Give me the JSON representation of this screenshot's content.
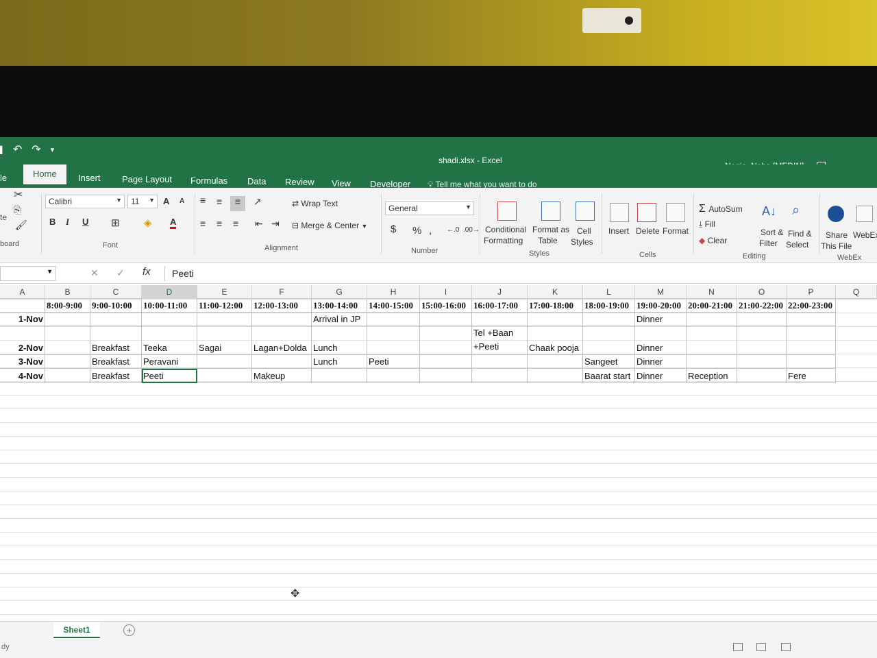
{
  "quick_access": {
    "undo": "↶",
    "redo": "↷"
  },
  "title": {
    "document": "shadi.xlsx  -  Excel",
    "user": "Nogia, Neha [MEDIN]"
  },
  "tabs": [
    "le",
    "Home",
    "Insert",
    "Page Layout",
    "Formulas",
    "Data",
    "Review",
    "View",
    "Developer"
  ],
  "tell_me": "Tell me what you want to do",
  "ribbon": {
    "clipboard_label": "board",
    "paste_partial": "te",
    "font_name": "Calibri",
    "font_size": "11",
    "font_label": "Font",
    "bold": "B",
    "italic": "I",
    "underline": "U",
    "grow_font": "A",
    "shrink_font": "A",
    "wrap_text": "Wrap Text",
    "merge_center": "Merge & Center",
    "alignment_label": "Alignment",
    "number_format": "General",
    "currency": "$",
    "percent": "%",
    "comma": ",",
    "number_label": "Number",
    "conditional_formatting": "Conditional",
    "conditional_formatting_2": "Formatting",
    "format_as_table": "Format as",
    "format_as_table_2": "Table",
    "cell_styles": "Cell",
    "cell_styles_2": "Styles",
    "styles_label": "Styles",
    "insert": "Insert",
    "delete": "Delete",
    "format": "Format",
    "cells_label": "Cells",
    "autosum": "AutoSum",
    "fill": "Fill",
    "clear": "Clear",
    "sort_filter": "Sort &",
    "sort_filter_2": "Filter",
    "find_select": "Find &",
    "find_select_2": "Select",
    "editing_label": "Editing",
    "share": "Share",
    "share_2": "This File",
    "webex": "WebEx",
    "webex_label": "WebEx"
  },
  "formula_bar": {
    "fx": "fx",
    "content": "Peeti"
  },
  "columns": [
    "A",
    "B",
    "C",
    "D",
    "E",
    "F",
    "G",
    "H",
    "I",
    "J",
    "K",
    "L",
    "M",
    "N",
    "O",
    "P",
    "Q"
  ],
  "header_row": [
    "8:00-9:00",
    "9:00-10:00",
    "10:00-11:00",
    "11:00-12:00",
    "12:00-13:00",
    "13:00-14:00",
    "14:00-15:00",
    "15:00-16:00",
    "16:00-17:00",
    "17:00-18:00",
    "18:00-19:00",
    "19:00-20:00",
    "20:00-21:00",
    "21:00-22:00",
    "22:00-23:00"
  ],
  "rows": [
    {
      "date": "1-Nov",
      "G": "Arrival in JP",
      "M": "Dinner"
    },
    {
      "date": "2-Nov",
      "C": "Breakfast",
      "D": "Teeka",
      "E": "Sagai",
      "F": "Lagan+Dolda",
      "G": "Lunch",
      "J1": "Tel +Baan",
      "J2": "+Peeti",
      "K": "Chaak pooja",
      "M": "Dinner"
    },
    {
      "date": "3-Nov",
      "C": "Breakfast",
      "D": "Peravani",
      "G": "Lunch",
      "H": "Peeti",
      "L": "Sangeet",
      "M": "Dinner"
    },
    {
      "date": "4-Nov",
      "C": "Breakfast",
      "D": "Peeti",
      "F": "Makeup",
      "L": "Baarat start",
      "M": "Dinner",
      "N": "Reception",
      "P": "Fere"
    }
  ],
  "sheet_tab": "Sheet1",
  "add_sheet": "+",
  "status": "dy"
}
